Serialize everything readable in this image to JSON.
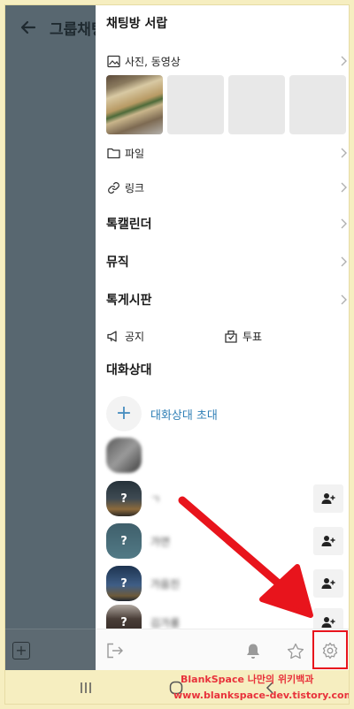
{
  "background_chat": {
    "title": "그룹채팅"
  },
  "drawer": {
    "title": "채팅방 서랍",
    "media_row": {
      "label": "사진, 동영상"
    },
    "file_row": {
      "label": "파일"
    },
    "link_row": {
      "label": "링크"
    },
    "calendar_row": {
      "label": "톡캘린더"
    },
    "music_row": {
      "label": "뮤직"
    },
    "board_row": {
      "label": "톡게시판"
    },
    "notice": {
      "label": "공지"
    },
    "vote": {
      "label": "투표"
    },
    "members_title": "대화상대",
    "invite_label": "대화상대 초대",
    "members": [
      {
        "name": "",
        "avatar_mark": ""
      },
      {
        "name": "ㄱ",
        "avatar_mark": "?"
      },
      {
        "name": "가연",
        "avatar_mark": "?"
      },
      {
        "name": "가음진",
        "avatar_mark": "?"
      },
      {
        "name": "김가룡",
        "avatar_mark": "?"
      }
    ]
  },
  "watermark": {
    "line1": "BlankSpace 나만의 위키백과",
    "line2": "www.blankspace-dev.tistory.com"
  },
  "colors": {
    "highlight": "#e8141c",
    "link_blue": "#2f7fb6",
    "overlay": "#586770"
  }
}
